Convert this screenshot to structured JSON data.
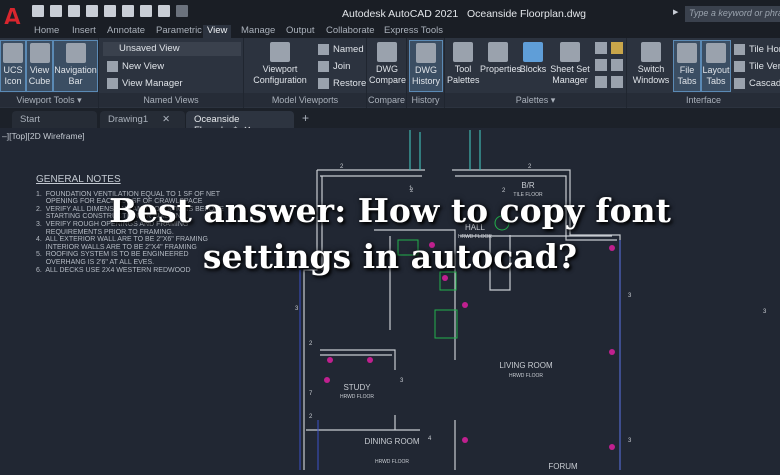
{
  "app": {
    "title": "Autodesk AutoCAD 2021",
    "file": "Oceanside Floorplan.dwg",
    "logo": "A",
    "search_placeholder": "Type a keyword or phrase"
  },
  "ribbon_tabs": [
    "Home",
    "Insert",
    "Annotate",
    "Parametric",
    "View",
    "Manage",
    "Output",
    "Collaborate",
    "Express Tools"
  ],
  "active_tab": "View",
  "panels": {
    "viewport_tools": {
      "label": "Viewport Tools ▾",
      "buttons": [
        "UCS Icon",
        "View Cube",
        "Navigation Bar"
      ]
    },
    "named_views": {
      "label": "Named Views",
      "dropdown": "Unsaved View",
      "buttons": [
        "New View",
        "View Manager"
      ]
    },
    "model_viewports": {
      "label": "Model Viewports",
      "big": "Viewport Configuration",
      "buttons": [
        "Named",
        "Join",
        "Restore"
      ]
    },
    "compare": {
      "label": "Compare",
      "big": "DWG Compare"
    },
    "history": {
      "label": "History",
      "big": "DWG History"
    },
    "palettes": {
      "label": "Palettes ▾",
      "buttons": [
        "Tool Palettes",
        "Properties",
        "Blocks",
        "Sheet Set Manager"
      ]
    },
    "interface": {
      "label": "Interface",
      "buttons": [
        "Switch Windows",
        "File Tabs",
        "Layout Tabs"
      ],
      "small": [
        "Tile Horizontally",
        "Tile Vertically",
        "Cascade"
      ]
    }
  },
  "doc_tabs": [
    {
      "label": "Start"
    },
    {
      "label": "Drawing1",
      "close": "✕"
    },
    {
      "label": "Oceanside Floorplan*",
      "close": "✕"
    }
  ],
  "add_tab": "+",
  "viewport_label": "–][Top][2D Wireframe]",
  "notes": {
    "title": "GENERAL NOTES",
    "lines": [
      "1.  FOUNDATION VENTILATION EQUAL TO 1 SF OF NET",
      "     OPENING FOR EACH 150 SF OF CRAWLSPACE",
      "2.  VERIFY ALL DIMENSIONS AND CONDITIONS BEFORE",
      "     STARTING CONSTRUCTION OR BUILDING.",
      "3.  VERIFY ROUGH OPENINGS AND FRAMING",
      "     REQUIREMENTS PRIOR TO FRAMING.",
      "4.  ALL EXTERIOR WALL ARE TO BE 2\"X6\" FRAMING",
      "     INTERIOR WALLS ARE TO BE 2\"X4\" FRAMING",
      "5.  ROOFING SYSTEM IS TO BE ENGINEERED",
      "     OVERHANG IS 2'6\" AT ALL EVES.",
      "6.  ALL DECKS USE 2X4 WESTERN REDWOOD"
    ]
  },
  "rooms": [
    {
      "name": "B/R",
      "floor": "TILE FLOOR"
    },
    {
      "name": "HALL",
      "floor": "HRWD FLOOR"
    },
    {
      "name": "LIVING ROOM",
      "floor": "HRWD FLOOR"
    },
    {
      "name": "STUDY",
      "floor": "HRWD FLOOR"
    },
    {
      "name": "DINING ROOM",
      "floor": "HRWD FLOOR"
    },
    {
      "name": "FORUM",
      "floor": ""
    }
  ],
  "overlay_title": {
    "line1": "Best answer: How to copy font",
    "line2": "settings in autocad?"
  },
  "colors": {
    "canvas": "#212733",
    "wall": "#c8ccd2",
    "accent_magenta": "#c0208f",
    "accent_green": "#22b14c",
    "cyan": "#3fb6b0",
    "logo_red": "#d8262e"
  }
}
